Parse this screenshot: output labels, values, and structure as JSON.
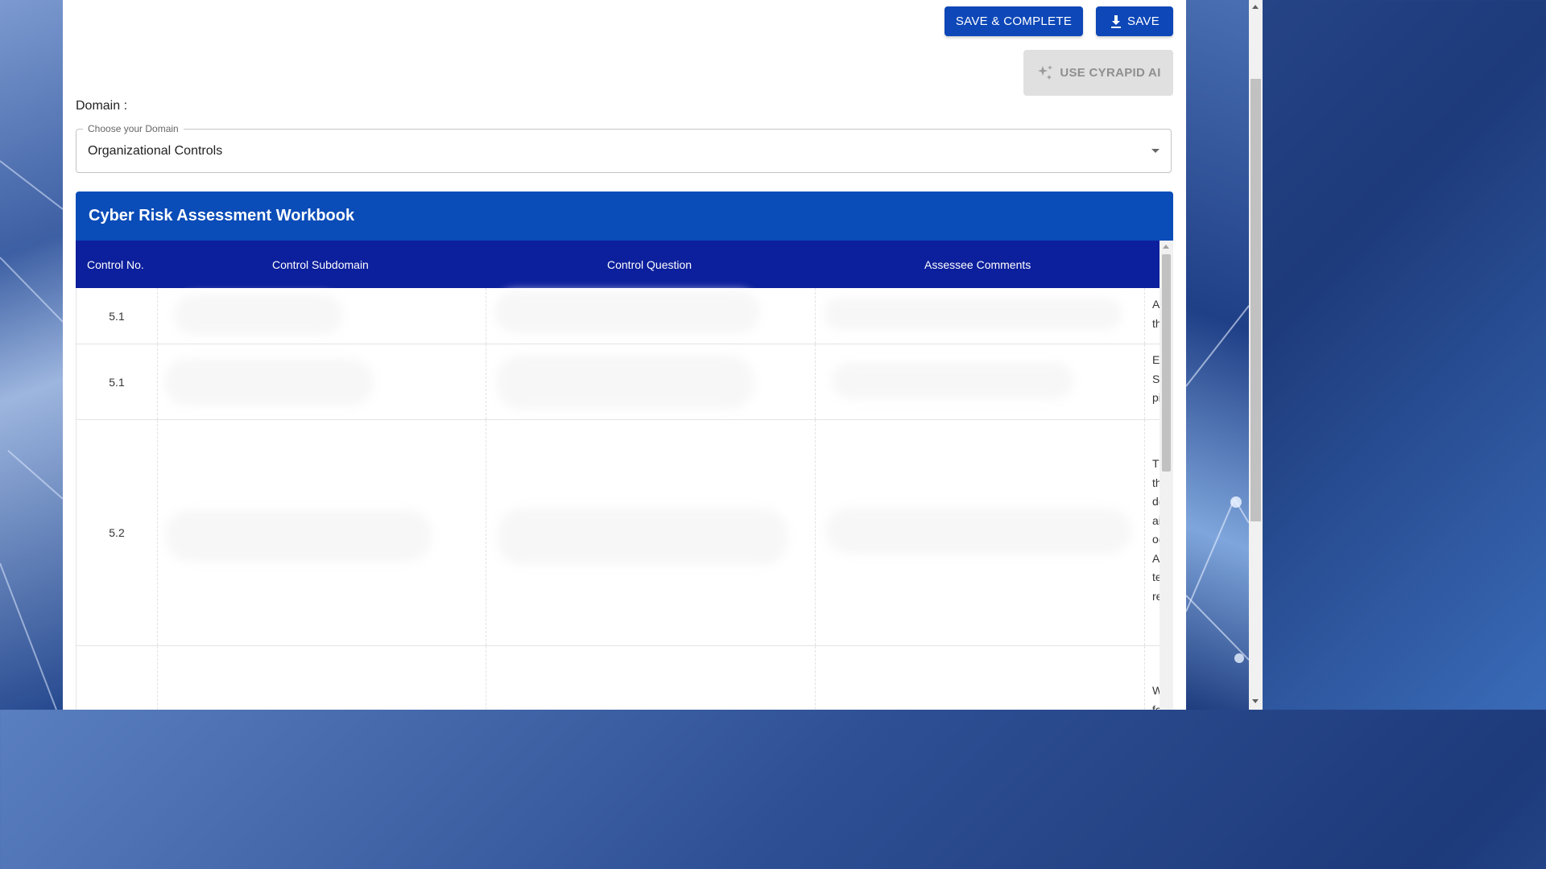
{
  "toolbar": {
    "save_complete_label": "SAVE & COMPLETE",
    "save_label": "SAVE",
    "ai_label": "USE CYRAPID AI"
  },
  "domain": {
    "label": "Domain :",
    "select_legend": "Choose your Domain",
    "selected_value": "Organizational Controls"
  },
  "workbook": {
    "title": "Cyber Risk Assessment Workbook",
    "columns": [
      "Control No.",
      "Control Subdomain",
      "Control Question",
      "Assessee Comments"
    ],
    "rows": [
      {
        "control_no": "5.1",
        "overflow_text": [
          "A",
          "th"
        ]
      },
      {
        "control_no": "5.1",
        "overflow_text": [
          "E",
          "S",
          "pi"
        ]
      },
      {
        "control_no": "5.2",
        "overflow_text": [
          "Tl",
          "th",
          "d(",
          "ai",
          "o(",
          "A",
          "te",
          "re"
        ]
      },
      {
        "control_no": "",
        "overflow_text": [
          "W",
          "fc"
        ]
      }
    ]
  },
  "colors": {
    "primary_button": "#0d47b8",
    "workbook_header": "#0a4cb8",
    "table_header": "#0c1f9c"
  }
}
